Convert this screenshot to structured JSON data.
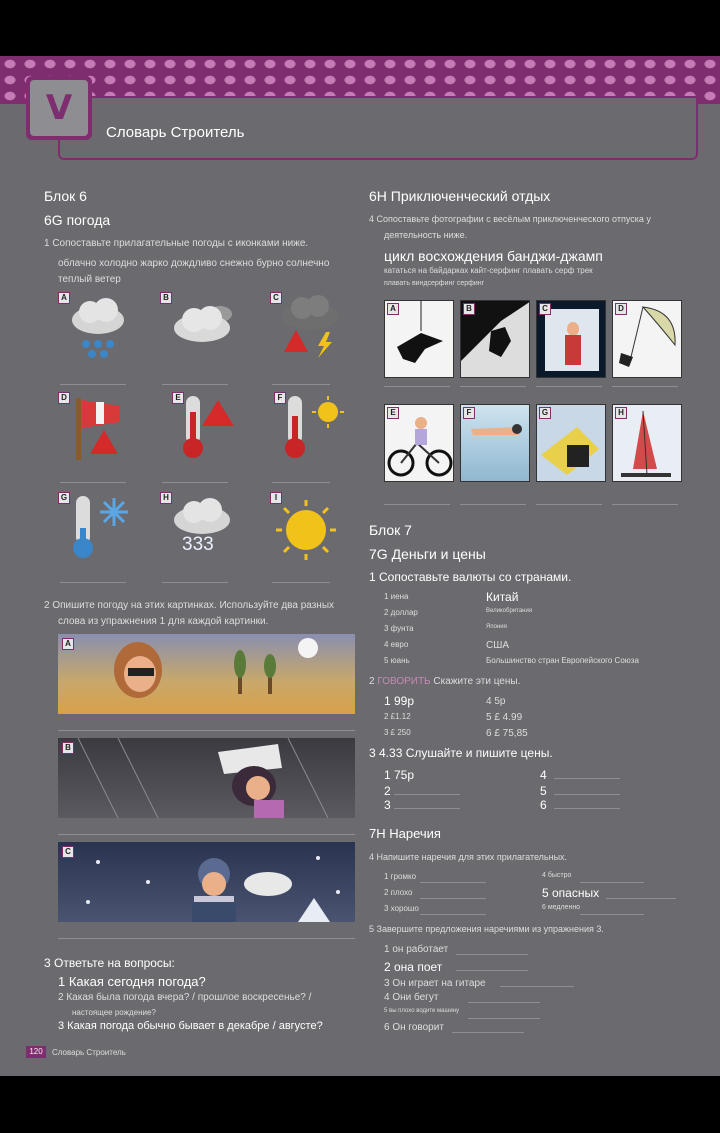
{
  "header": {
    "unit_letter": "V",
    "title": "Словарь Строитель"
  },
  "left": {
    "block_title": "Блок 6",
    "section_title": "6G погода",
    "ex1": "1 Сопоставьте прилагательные погоды с иконками ниже.",
    "ex1_words": "облачно холодно жарко дождливо снежно бурно солнечно",
    "ex1_words2": "теплый ветер",
    "tiles": [
      "A",
      "B",
      "C",
      "D",
      "E",
      "F",
      "G",
      "H",
      "I"
    ],
    "tile_h_label": "333",
    "ex2_line1": "2 Опишите погоду на этих картинках.  Используйте два разных",
    "ex2_line2": "слова из упражнения 1 для каждой картинки.",
    "scenes": [
      "A",
      "B",
      "C"
    ],
    "ex3": "3 Ответьте на вопросы:",
    "q1": "1 Какая сегодня погода?",
    "q2": "2 Какая была погода вчера? / прошлое воскресенье? /",
    "q2b": "настоящее рождение?",
    "q3": "3 Какая погода обычно бывает в декабре / августе?"
  },
  "right": {
    "section_h": "6H Приключенческий отдых",
    "ex4_line1": "4 Сопоставьте фотографии с весёлым приключенческого отпуска у",
    "ex4_line2": "деятельность ниже.",
    "ex4_words": "цикл восхождения банджи-джамп",
    "ex4_words2": "кататься на байдарках кайт-серфинг плавать серф трек",
    "ex4_words3": "плавать виндсерфинг серфинг",
    "photos": [
      "A",
      "B",
      "C",
      "D",
      "E",
      "F",
      "G",
      "H"
    ],
    "block7": "Блок 7",
    "section_7g": "7G Деньги и цены",
    "ex1": "1 Сопоставьте валюты со странами.",
    "currencies": [
      "1 иена",
      "2 доллар",
      "3 фунта",
      "4 евро",
      "5 юань"
    ],
    "countries": [
      "Китай",
      "Великобритания",
      "Япония",
      "США",
      "Большинство стран Европейского Союза"
    ],
    "ex2_label": "2 ",
    "ex2_tag": "ГОВОРИТЬ",
    "ex2_text": " Скажите эти цены.",
    "prices_left": [
      "1 99p",
      "2 £1.12",
      "3 £ 250"
    ],
    "prices_right": [
      "4 5p",
      "5 £ 4.99",
      "6 £ 75,85"
    ],
    "ex3": "3 4.33 Слушайте и пишите цены.",
    "listen_left": [
      "1 75p",
      "2",
      "3"
    ],
    "listen_right": [
      "4",
      "5",
      "6"
    ],
    "section_7h": "7H Наречия",
    "ex4": "4 Напишите наречия для этих прилагательных.",
    "adj_left": [
      "1 громко",
      "2 плохо",
      "3 хорошо"
    ],
    "adj_right": [
      "4 быстро",
      "5 опасных",
      "6 медленно"
    ],
    "ex5": "5 Завершите предложения наречиями из упражнения 3.",
    "sentences": [
      "1 он работает",
      "2 она поет",
      "3 Он играет на гитаре",
      "4 Они бегут",
      "5 вы плохо водите машину",
      "6 Он говорит"
    ]
  },
  "footer": {
    "page": "120",
    "label": "Словарь Строитель"
  }
}
